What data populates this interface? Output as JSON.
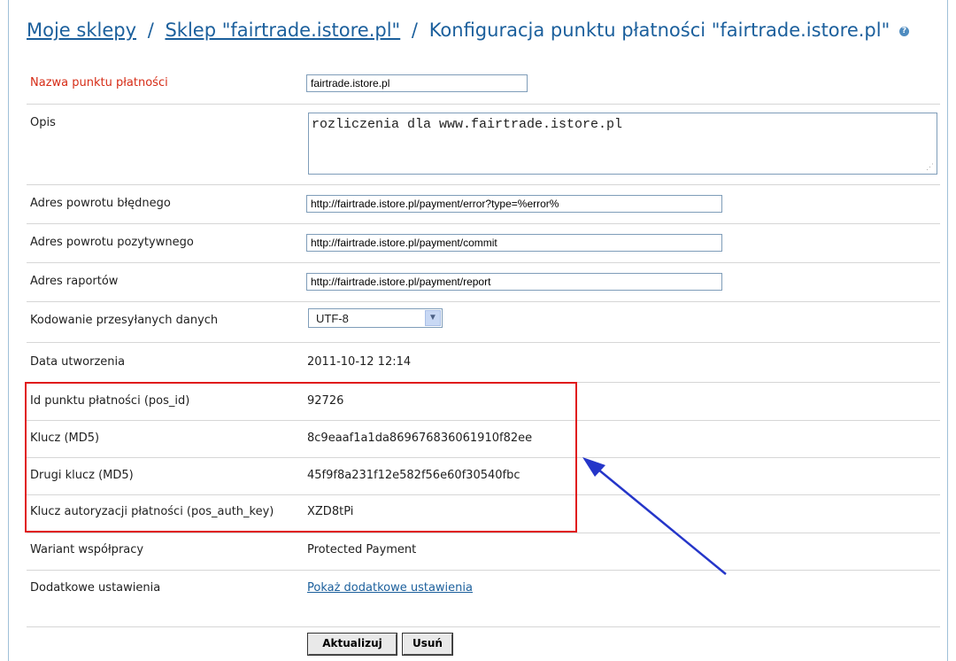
{
  "breadcrumb": {
    "shops": "Moje sklepy",
    "separator": "/",
    "shop": "Sklep \"fairtrade.istore.pl\"",
    "current": "Konfiguracja punktu płatności \"fairtrade.istore.pl\""
  },
  "form": {
    "name_label": "Nazwa punktu płatności",
    "name_value": "fairtrade.istore.pl",
    "description_label": "Opis",
    "description_value": "rozliczenia dla www.fairtrade.istore.pl",
    "error_url_label": "Adres powrotu błędnego",
    "error_url_value": "http://fairtrade.istore.pl/payment/error?type=%error%",
    "success_url_label": "Adres powrotu pozytywnego",
    "success_url_value": "http://fairtrade.istore.pl/payment/commit",
    "report_url_label": "Adres raportów",
    "report_url_value": "http://fairtrade.istore.pl/payment/report",
    "encoding_label": "Kodowanie przesyłanych danych",
    "encoding_value": "UTF-8",
    "created_label": "Data utworzenia",
    "created_value": "2011-10-12 12:14",
    "pos_id_label": "Id punktu płatności (pos_id)",
    "pos_id_value": "92726",
    "key1_label": "Klucz (MD5)",
    "key1_value": "8c9eaaf1a1da869676836061910f82ee",
    "key2_label": "Drugi klucz (MD5)",
    "key2_value": "45f9f8a231f12e582f56e60f30540fbc",
    "auth_key_label": "Klucz autoryzacji płatności (pos_auth_key)",
    "auth_key_value": "XZD8tPi",
    "variant_label": "Wariant współpracy",
    "variant_value": "Protected Payment",
    "extra_label": "Dodatkowe ustawienia",
    "extra_link": "Pokaż dodatkowe ustawienia"
  },
  "buttons": {
    "update": "Aktualizuj",
    "delete": "Usuń"
  },
  "colors": {
    "link": "#1b5f9c",
    "required_label": "#d62c16",
    "highlight": "#e0191b",
    "arrow": "#2536c9"
  }
}
